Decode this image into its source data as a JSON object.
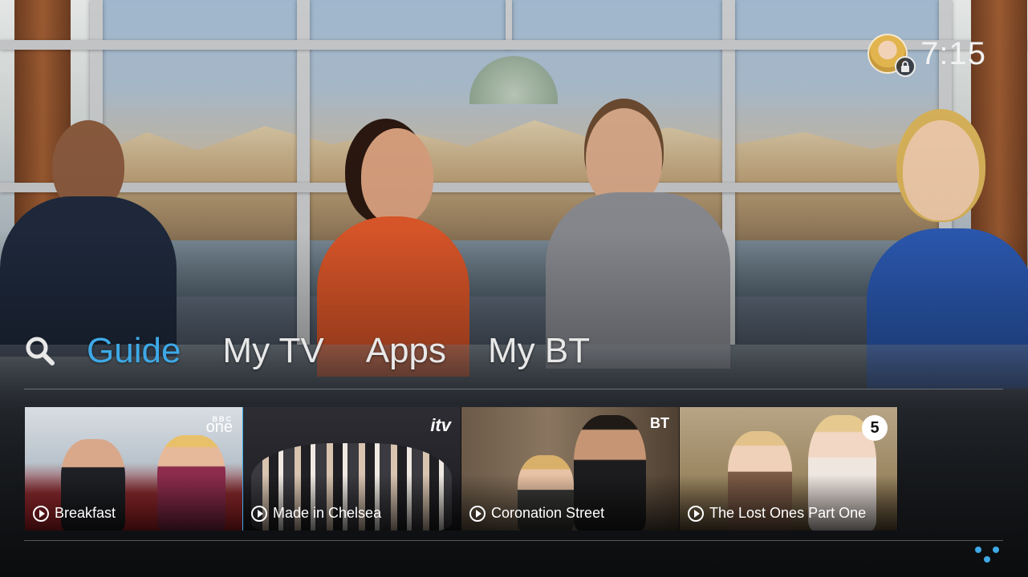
{
  "status": {
    "time": "7:15",
    "avatar_icon": "user-avatar",
    "lock_icon": "padlock-icon"
  },
  "nav": {
    "search_icon": "search-icon",
    "tabs": [
      {
        "label": "Guide",
        "active": true
      },
      {
        "label": "My TV",
        "active": false
      },
      {
        "label": "Apps",
        "active": false
      },
      {
        "label": "My BT",
        "active": false
      }
    ]
  },
  "tiles": [
    {
      "title": "Breakfast",
      "channel": "BBC one",
      "focused": true
    },
    {
      "title": "Made in Chelsea",
      "channel": "itv",
      "focused": false
    },
    {
      "title": "Coronation Street",
      "channel": "BT",
      "focused": false
    },
    {
      "title": "The Lost Ones Part One",
      "channel": "5",
      "focused": false
    }
  ],
  "logos": {
    "bbc_top": "BBC",
    "bbc_bottom": "one",
    "itv": "itv",
    "bt": "BT",
    "five": "5"
  },
  "colors": {
    "accent": "#3ea9e6",
    "text": "#e8e8e8"
  }
}
